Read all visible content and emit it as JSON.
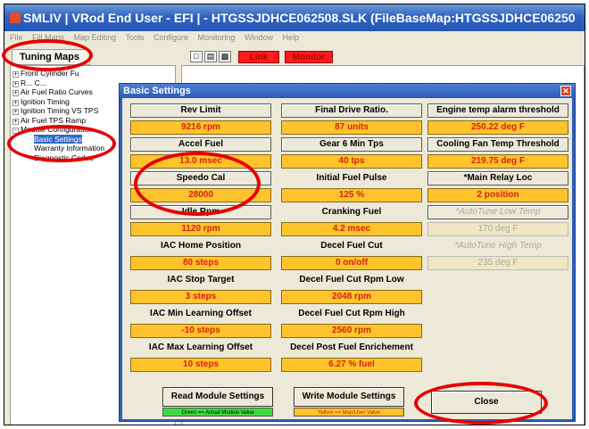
{
  "window": {
    "title": "SMLIV  | VRod End User - EFI |  - HTGSSJDHCE062508.SLK     (FileBaseMap:HTGSSJDHCE06250",
    "menu": [
      "File",
      "Fill Maps",
      "Map Editing",
      "Tools",
      "Configure",
      "Monitoring",
      "Window",
      "Help"
    ]
  },
  "tree": {
    "tab_label": "Tuning Maps",
    "items": [
      {
        "label": "Front Cylinder Fu",
        "expander": "+",
        "level": 0
      },
      {
        "label": "R... C...",
        "expander": "+",
        "level": 0
      },
      {
        "label": "Air Fuel Ratio Curves",
        "expander": "+",
        "level": 0
      },
      {
        "label": "Ignition Timing",
        "expander": "+",
        "level": 0
      },
      {
        "label": "Ignition Timing VS TPS",
        "expander": "+",
        "level": 0
      },
      {
        "label": "Air Fuel TPS Ramp",
        "expander": "+",
        "level": 0
      },
      {
        "label": "Module Configuration",
        "expander": "-",
        "level": 0
      },
      {
        "label": "Basic Settings",
        "expander": "",
        "level": 1
      },
      {
        "label": "Warranty Information",
        "expander": "",
        "level": 1
      },
      {
        "label": "Diagnostic Codes",
        "expander": "",
        "level": 1
      }
    ]
  },
  "toolbar": {
    "icons": [
      "new-file-icon",
      "open-folder-icon",
      "save-disk-icon"
    ],
    "link_label": "Link",
    "monitor_label": "Monitor"
  },
  "dialog": {
    "title": "Basic Settings",
    "col1": [
      {
        "label": "Rev Limit",
        "value": "9216 rpm"
      },
      {
        "label": "Accel Fuel",
        "value": "13.0 msec"
      },
      {
        "label": "Speedo Cal",
        "value": "28000"
      },
      {
        "label": "Idle Rpm",
        "value": "1120 rpm"
      },
      {
        "label": "IAC Home Position",
        "value": "80 steps"
      },
      {
        "label": "IAC Stop Target",
        "value": "3 steps"
      },
      {
        "label": "IAC Min Learning Offset",
        "value": "-10 steps"
      },
      {
        "label": "IAC Max Learning Offset",
        "value": "10 steps"
      }
    ],
    "col2": [
      {
        "label": "Final Drive Ratio.",
        "value": "87 units"
      },
      {
        "label": "Gear 6 Min Tps",
        "value": "40 tps"
      },
      {
        "label": "Initial Fuel Pulse",
        "value": "125 %"
      },
      {
        "label": "Cranking Fuel",
        "value": "4.2 msec"
      },
      {
        "label": "Decel Fuel Cut",
        "value": "0 on/off"
      },
      {
        "label": "Decel Fuel Cut Rpm Low",
        "value": "2048 rpm"
      },
      {
        "label": "Decel Fuel Cut Rpm High",
        "value": "2560 rpm"
      },
      {
        "label": "Decel Post Fuel Enrichement",
        "value": "6.27 % fuel"
      }
    ],
    "col3": [
      {
        "label": "Engine temp alarm threshold",
        "value": "250.22 deg F"
      },
      {
        "label": "Cooling Fan Temp Threshold",
        "value": "219.75 deg F"
      },
      {
        "label": "*Main Relay Loc",
        "value": "2 position"
      },
      {
        "label": "*AutoTune Low Temp",
        "value": "170 deg F"
      },
      {
        "label": "*AutoTune High Temp",
        "value": "235 deg F"
      }
    ],
    "read_label": "Read Module Settings",
    "write_label": "Write Module Settings",
    "read_legend": "Green == Actual Module Value",
    "write_legend": "Yellow == Map/User Value",
    "close_label": "Close"
  },
  "colors": {
    "value_bg": "#ffc32b",
    "value_text": "#d3230d",
    "annotation": "#e60000",
    "legend_green": "#3cdc3c",
    "legend_yellow": "#ffc32b"
  }
}
